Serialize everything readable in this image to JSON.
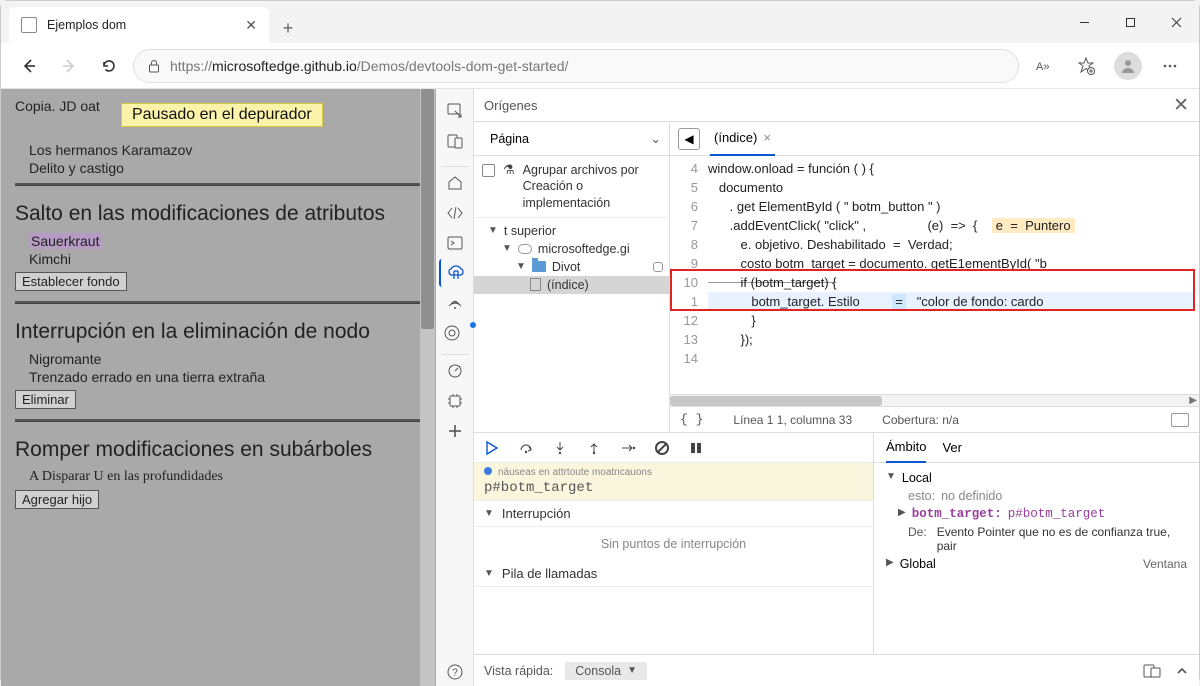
{
  "window": {
    "tab_title": "Ejemplos dom",
    "url_prefix": "https://",
    "url_domain": "microsoftedge.github.io",
    "url_path": "/Demos/devtools-dom-get-started/"
  },
  "page": {
    "line1": "Copia. JD oat",
    "paused_banner": "Pausado en el depurador",
    "line2": "Los hermanos Karamazov",
    "line3": "Delito y castigo",
    "section1_title": "Salto en las modificaciones de atributos",
    "s1_item1": "Sauerkraut",
    "s1_item2": "Kimchi",
    "s1_button": "Establecer fondo",
    "section2_title": "Interrupción en la eliminación de nodo",
    "s2_item1": "Nigromante",
    "s2_item2": "Trenzado errado en una tierra extraña",
    "s2_button": "Eliminar",
    "section3_title": "Romper modificaciones en subárboles",
    "s3_item1": "Disparar U en las profundidades",
    "s3_button": "Agregar hijo"
  },
  "devtools": {
    "header_title": "Orígenes",
    "nav_tab": "Página",
    "group_label": "Agrupar archivos por Creación o implementación",
    "tree": {
      "top": "t superior",
      "domain": "microsoftedge.gi",
      "folder": "Divot",
      "file": "(índice)"
    },
    "editor_tab": "(índice)",
    "code": {
      "l4": "window.onload = función ( ) {",
      "l5": "   documento",
      "l6": "      . get ElementById ( \" botm_button \" )",
      "l7a": "      .addEventClick( \"click\" ,",
      "l7b": "(e)  =>  {",
      "l7c": "e  =  Puntero",
      "l8a": "         e. objetivo. Deshabilitado  =",
      "l8b": "Verdad",
      "l9": "         costo botm_target = documento. getE1ementById( \"b",
      "l10": "         if (botm_target) {",
      "l11a": "botm_target. Estilo",
      "l11b": "\"color de fondo: cardo",
      "l12": "            }",
      "l13": "         });"
    },
    "status": {
      "braces": "{ }",
      "pos": "Línea 1 1, columna 33",
      "cov": "Cobertura: n/a"
    },
    "dbg": {
      "mini_text": "náuseas en attrtoute moatncauons",
      "pid": "p#botm_target",
      "acc1": "Interrupción",
      "acc1_body": "Sin puntos de interrupción",
      "acc2": "Pila de llamadas"
    },
    "scope": {
      "tab1": "Ámbito",
      "tab2": "Ver",
      "local": "Local",
      "this_lbl": "esto:",
      "this_val": "no definido",
      "bt_name": "botm_target:",
      "bt_val": "p#botm_target",
      "de_lbl": "De:",
      "de_text": "Evento Pointer que no es de confianza true, pair",
      "global": "Global",
      "global_rhs": "Ventana"
    },
    "footer": {
      "label": "Vista rápida:",
      "select": "Consola"
    }
  }
}
